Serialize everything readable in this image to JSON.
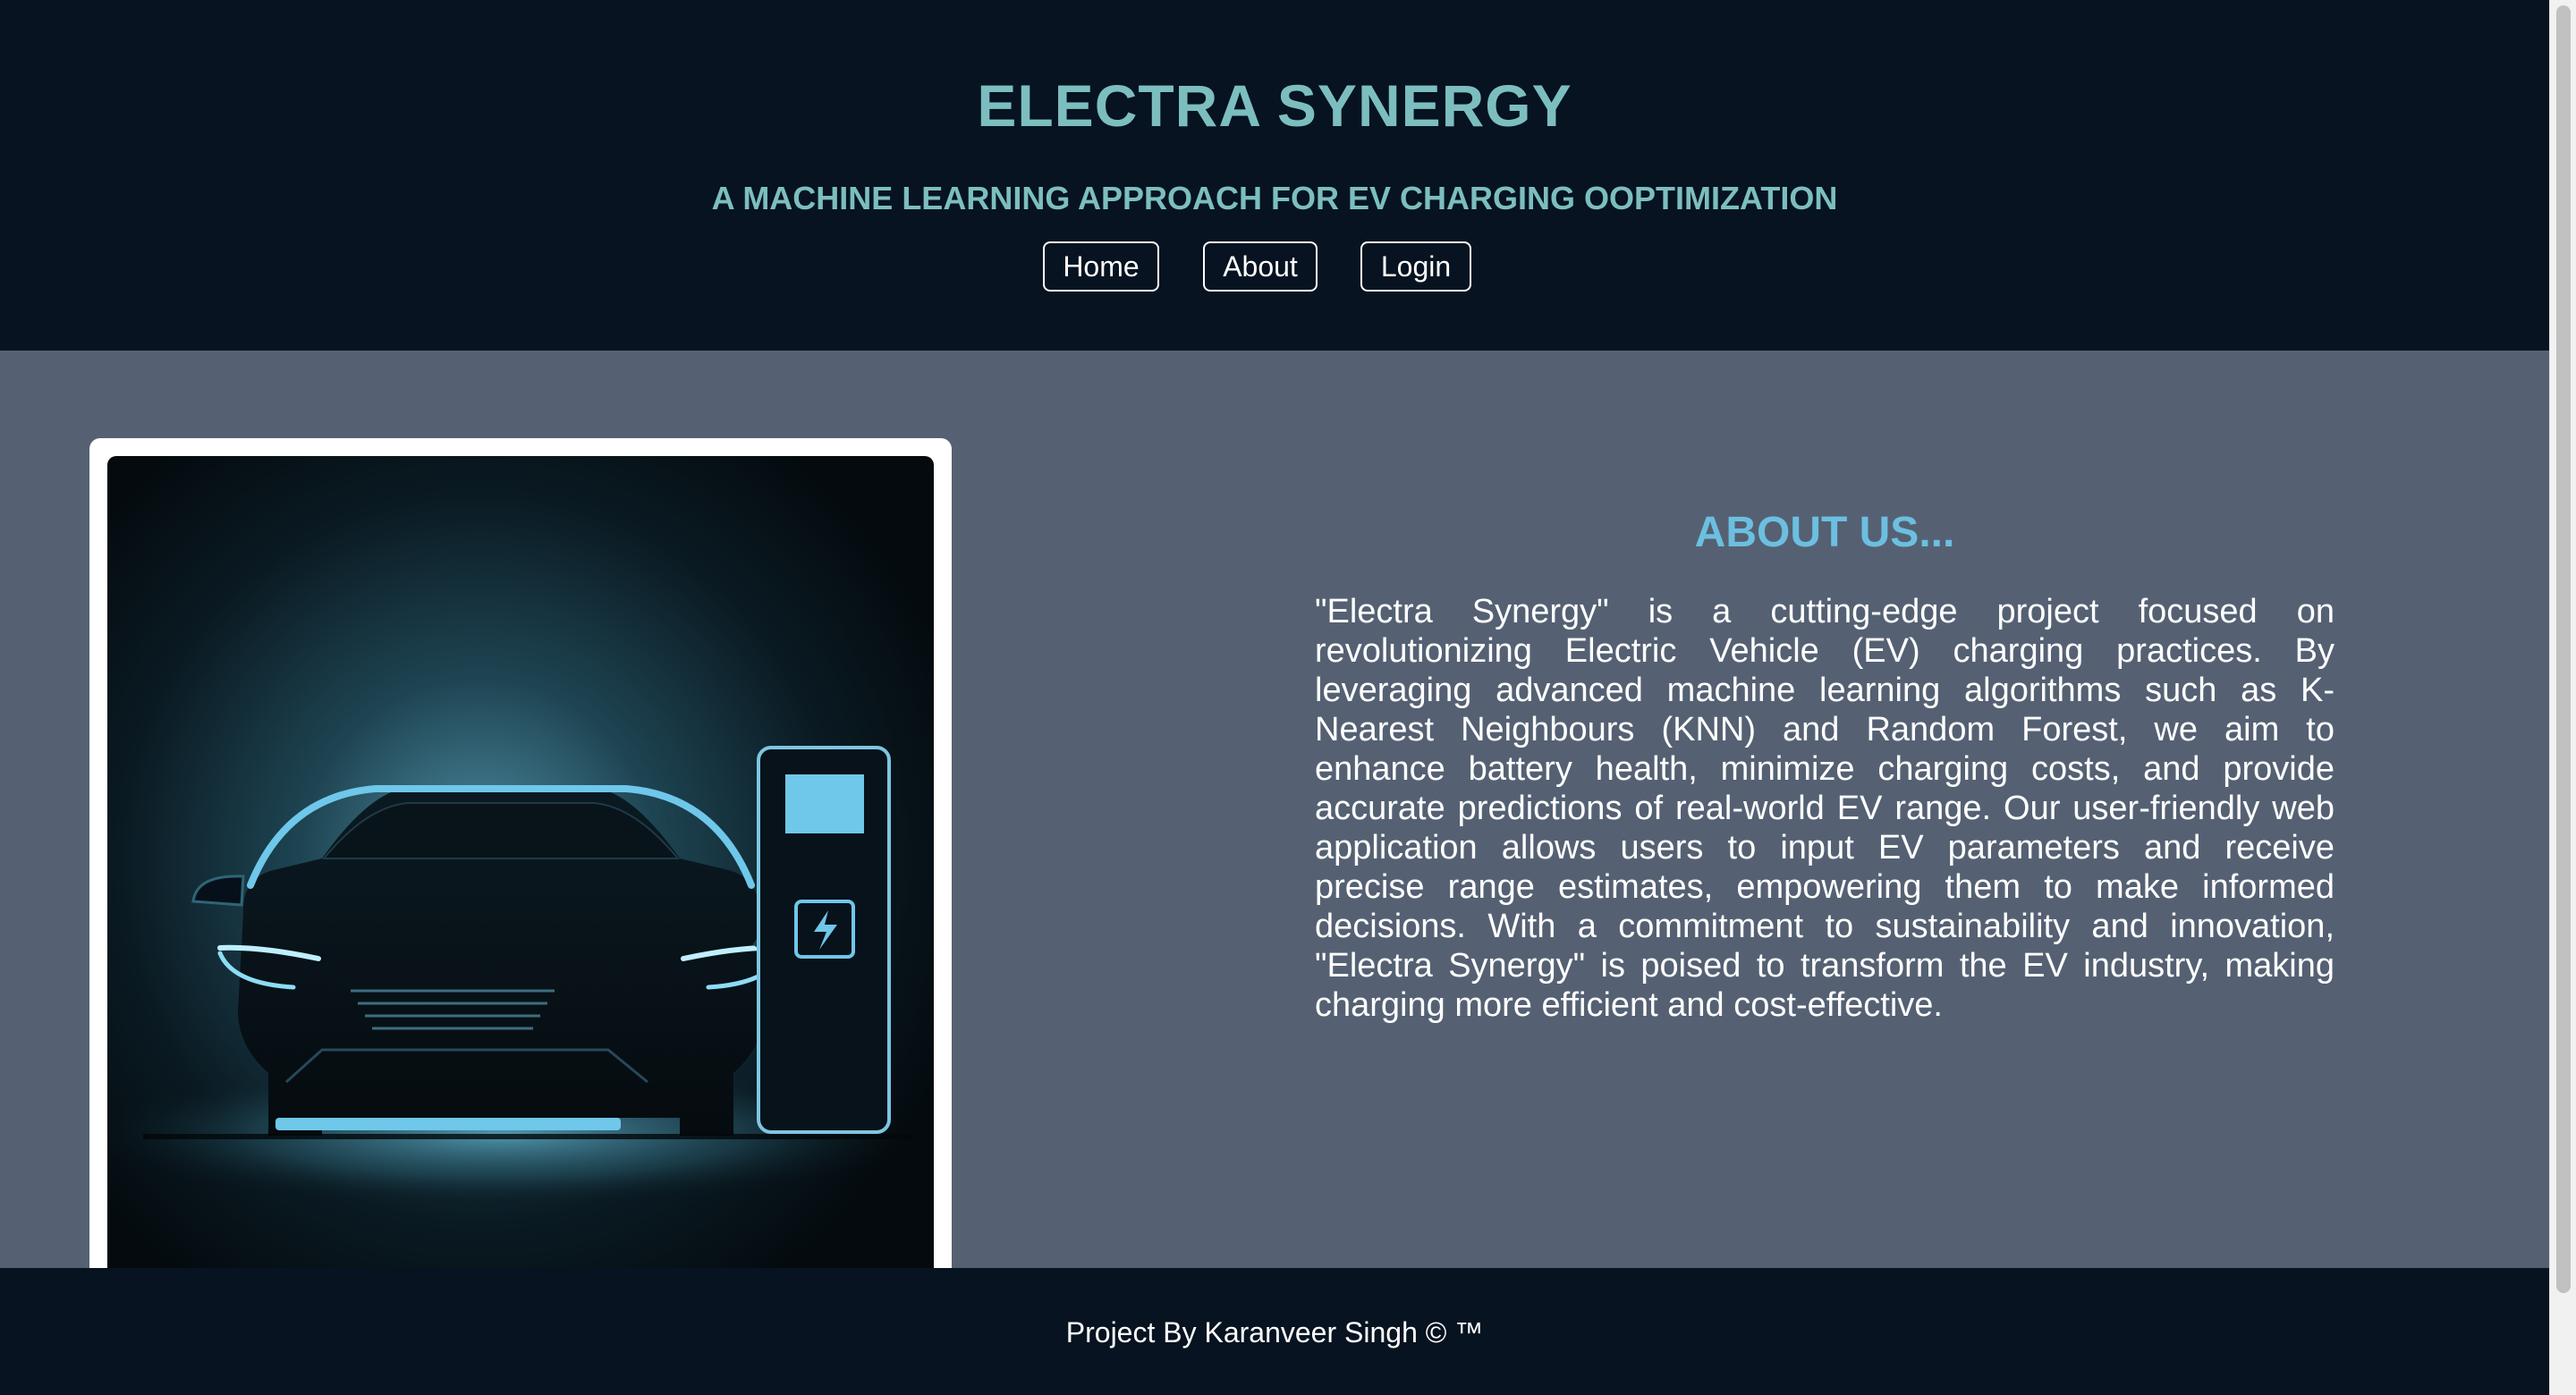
{
  "header": {
    "title": "ELECTRA SYNERGY",
    "subtitle": "A MACHINE LEARNING APPROACH FOR EV CHARGING OOPTIMIZATION"
  },
  "nav": {
    "home": "Home",
    "about": "About",
    "login": "Login"
  },
  "hero_image": {
    "icon": "electric-car-charging-illustration"
  },
  "about": {
    "title": "ABOUT US...",
    "body": "\"Electra Synergy\" is a cutting-edge project focused on revolutionizing Electric Vehicle (EV) charging practices. By leveraging advanced machine learning algorithms such as K-Nearest Neighbours (KNN) and Random Forest, we aim to enhance battery health, minimize charging costs, and provide accurate predictions of real-world EV range. Our user-friendly web application allows users to input EV parameters and receive precise range estimates, empowering them to make informed decisions. With a commitment to sustainability and innovation, \"Electra Synergy\" is poised to transform the EV industry, making charging more efficient and cost-effective."
  },
  "footer": {
    "text": "Project By Karanveer Singh © ™"
  },
  "colors": {
    "header_bg": "#071320",
    "main_bg": "#556173",
    "title_color": "#7cbec0",
    "about_title_color": "#6cbfe0",
    "accent_glow": "#6fc7ea"
  }
}
